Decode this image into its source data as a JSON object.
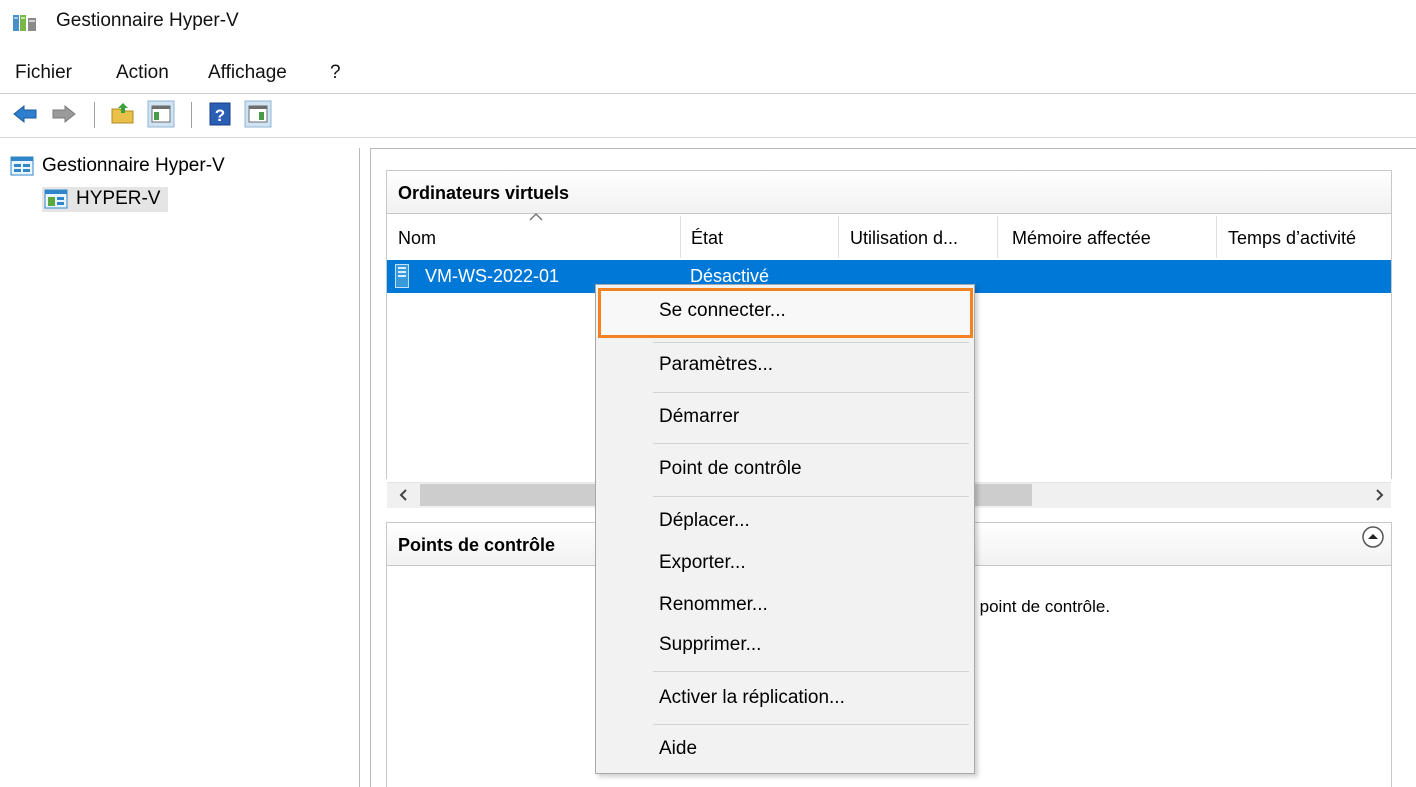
{
  "window": {
    "title": "Gestionnaire Hyper-V"
  },
  "menu": {
    "items": [
      "Fichier",
      "Action",
      "Affichage",
      "?"
    ]
  },
  "tree": {
    "root": "Gestionnaire Hyper-V",
    "child": "HYPER-V"
  },
  "vm_panel": {
    "title": "Ordinateurs virtuels",
    "columns": [
      "Nom",
      "État",
      "Utilisation d...",
      "Mémoire affectée",
      "Temps d’activité"
    ],
    "rows": [
      {
        "name": "VM-WS-2022-01",
        "state": "Désactivé",
        "selected": true
      }
    ]
  },
  "checkpoints_panel": {
    "title": "Points de contrôle",
    "message": "de point de contrôle."
  },
  "context_menu": {
    "items": [
      "Se connecter...",
      "Paramètres...",
      "Démarrer",
      "Point de contrôle",
      "Déplacer...",
      "Exporter...",
      "Renommer...",
      "Supprimer...",
      "Activer la réplication...",
      "Aide"
    ],
    "highlighted_index": 0,
    "highlight_color": "#f58220"
  },
  "colors": {
    "selection": "#0078d7",
    "highlight_border": "#f58220"
  }
}
